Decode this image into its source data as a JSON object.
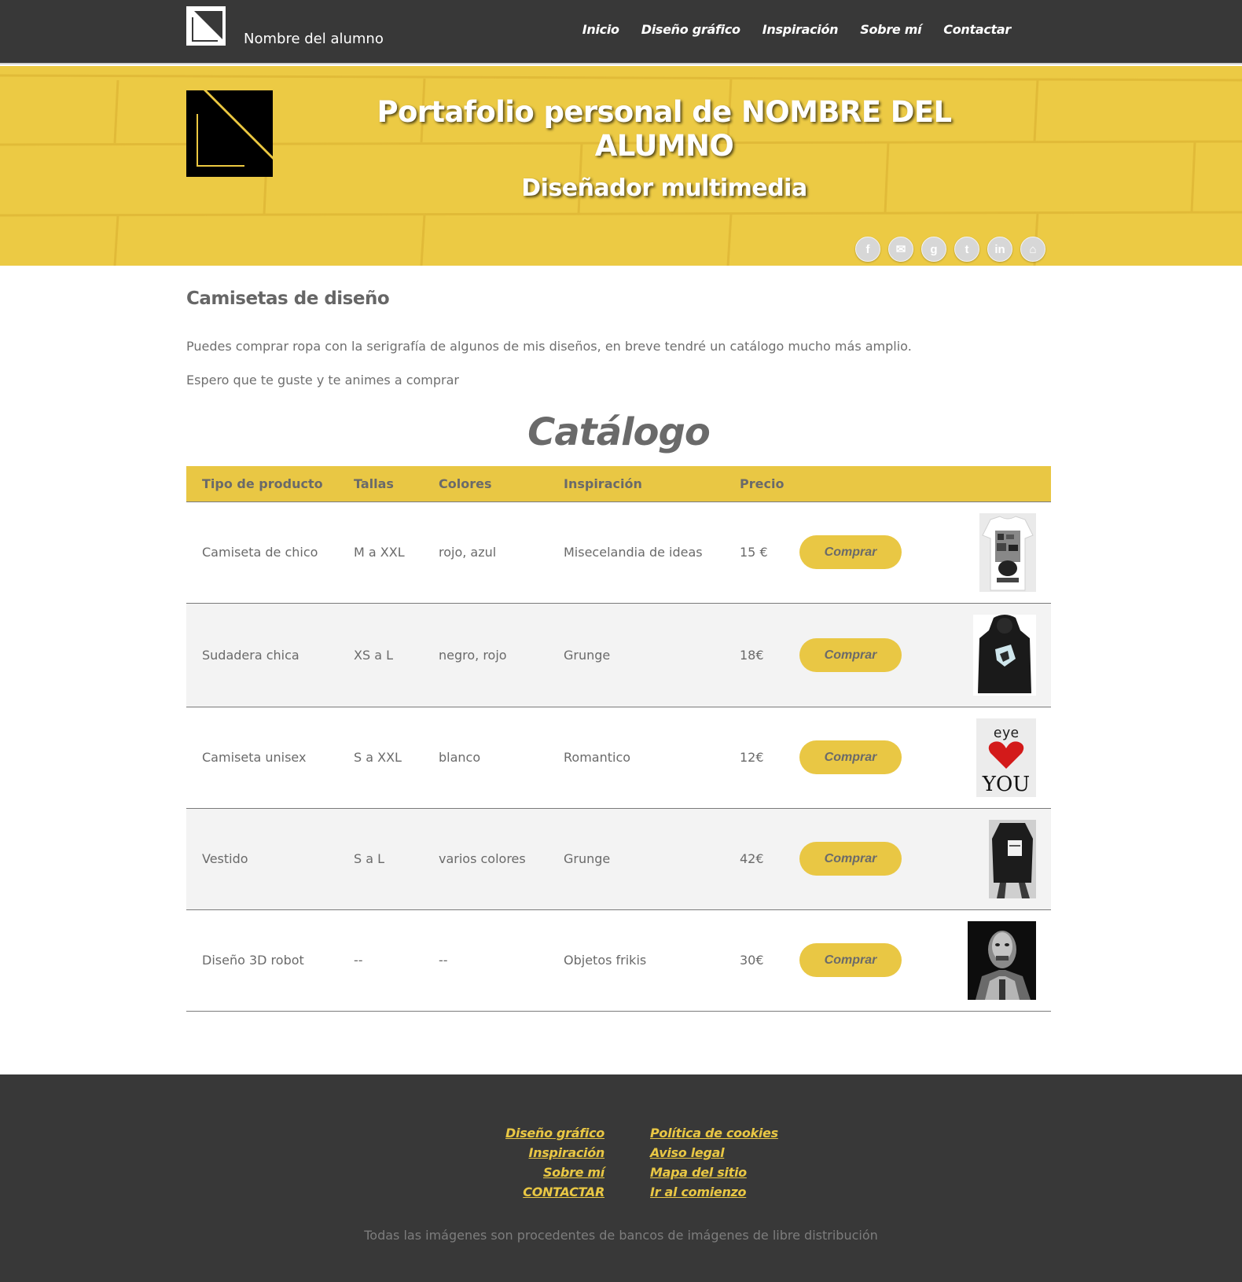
{
  "header": {
    "student_name": "Nombre del alumno",
    "nav": [
      "Inicio",
      "Diseño gráfico",
      "Inspiración",
      "Sobre mí",
      "Contactar"
    ]
  },
  "hero": {
    "title": "Portafolio personal de NOMBRE DEL ALUMNO",
    "subtitle": "Diseñador multimedia",
    "socials": [
      {
        "name": "facebook-icon",
        "glyph": "f"
      },
      {
        "name": "email-icon",
        "glyph": "✉"
      },
      {
        "name": "google-icon",
        "glyph": "g"
      },
      {
        "name": "twitter-icon",
        "glyph": "t"
      },
      {
        "name": "linkedin-icon",
        "glyph": "in"
      },
      {
        "name": "github-icon",
        "glyph": "⌂"
      }
    ]
  },
  "main": {
    "section_title": "Camisetas de diseño",
    "intro_1": "Puedes comprar ropa con la serigrafía de algunos de mis diseños, en breve tendré un catálogo mucho más amplio.",
    "intro_2": "Espero que te guste y te animes a comprar",
    "catalog_title": "Catálogo"
  },
  "catalog": {
    "headers": [
      "Tipo de producto",
      "Tallas",
      "Colores",
      "Inspiración",
      "Precio",
      "",
      ""
    ],
    "buy_label": "Comprar",
    "rows": [
      {
        "type": "Camiseta de chico",
        "sizes": "M a XXL",
        "colors": "rojo, azul",
        "inspiration": "Misecelandia de ideas",
        "price": "15 €",
        "image": "white-tshirt-thumbnail"
      },
      {
        "type": "Sudadera chica",
        "sizes": "XS a L",
        "colors": "negro, rojo",
        "inspiration": "Grunge",
        "price": "18€",
        "image": "black-hoodie-thumbnail"
      },
      {
        "type": "Camiseta unisex",
        "sizes": "S a XXL",
        "colors": "blanco",
        "inspiration": "Romantico",
        "price": "12€",
        "image": "eye-heart-you-thumbnail"
      },
      {
        "type": "Vestido",
        "sizes": "S a L",
        "colors": "varios colores",
        "inspiration": "Grunge",
        "price": "42€",
        "image": "black-dress-thumbnail"
      },
      {
        "type": "Diseño 3D robot",
        "sizes": "--",
        "colors": "--",
        "inspiration": "Objetos frikis",
        "price": "30€",
        "image": "robot-3d-thumbnail"
      }
    ],
    "thumb_text": {
      "eye": "eye",
      "you": "YOU"
    }
  },
  "footer": {
    "links_left": [
      "Diseño gráfico",
      "Inspiración",
      "Sobre mí",
      "CONTACTAR"
    ],
    "links_right": [
      "Política de cookies",
      "Aviso legal",
      "Mapa del sitio",
      "Ir al comienzo"
    ],
    "note": "Todas las imágenes son procedentes de bancos de imágenes de libre distribución"
  },
  "colors": {
    "dark": "#383838",
    "accent_yellow": "#e9c744",
    "row_alt": "#f3f3f3"
  }
}
